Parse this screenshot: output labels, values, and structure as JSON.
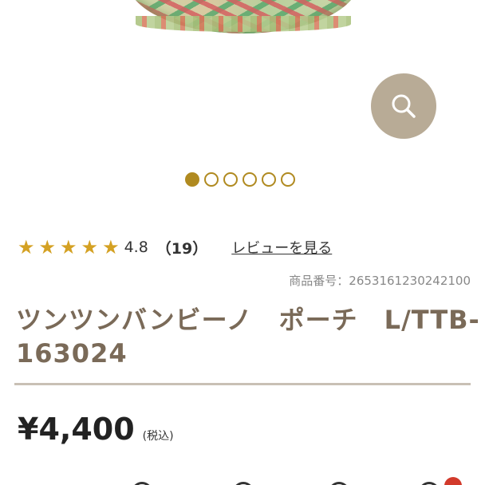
{
  "product": {
    "rating": {
      "stars": 5,
      "value": "4.8",
      "count": "（19）",
      "review_link": "レビューを見る"
    },
    "sku": "商品番号：2653161230242100",
    "title_line1": "ツンツンバンビーノ　ポーチ　L/TTB-",
    "title_line2": "163024",
    "price": "¥4,400",
    "tax_note": "(税込)"
  },
  "gallery": {
    "image_count": 6,
    "active_index": 0
  },
  "colors": {
    "accent_gold": "#b08a20",
    "star": "#d4a123",
    "zoom_button": "#b8ab96",
    "title_text": "#7a6a58",
    "badge": "#d23a2b"
  }
}
